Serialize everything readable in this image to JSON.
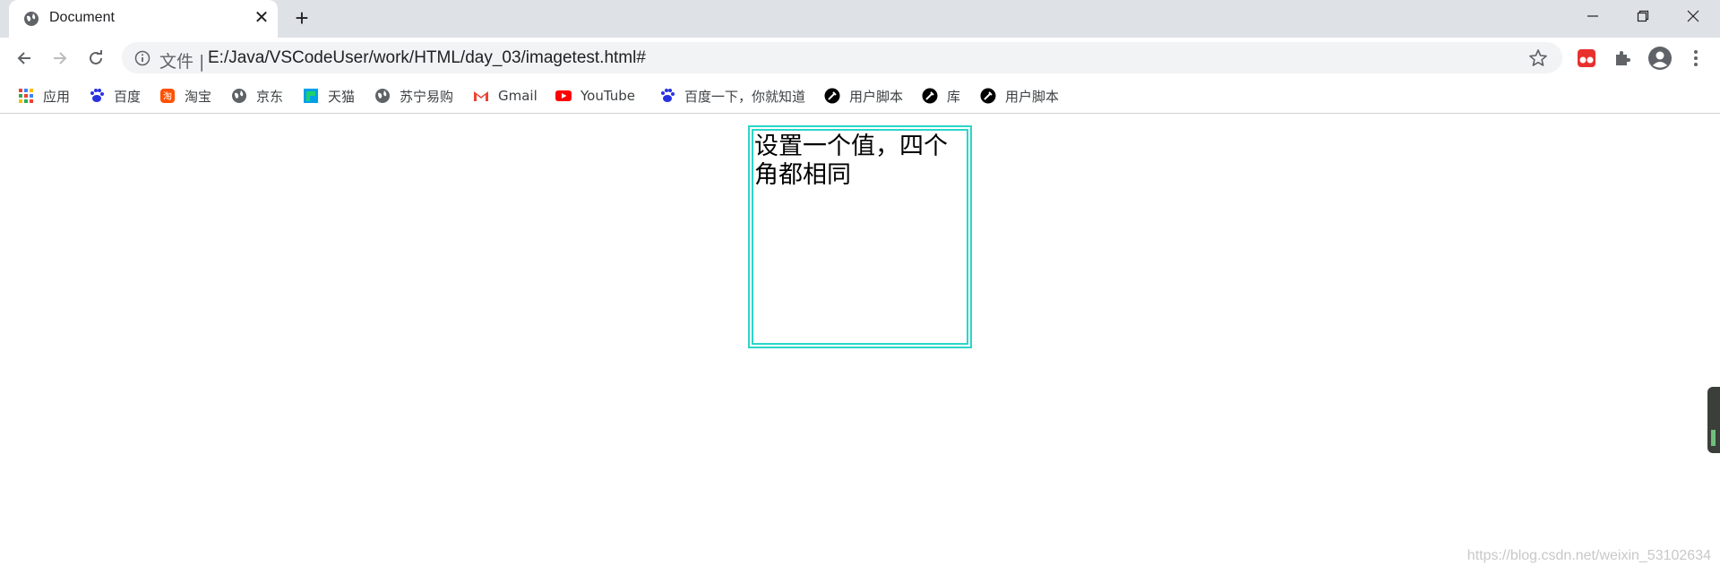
{
  "browser": {
    "tab_title": "Document",
    "address": {
      "file_label": "文件 |",
      "url": "E:/Java/VSCodeUser/work/HTML/day_03/imagetest.html#"
    }
  },
  "bookmarks": [
    {
      "label": "应用",
      "icon": "apps-grid-icon",
      "color": "#4285f4"
    },
    {
      "label": "百度",
      "icon": "baidu-paw-icon",
      "color": "#2932e1"
    },
    {
      "label": "淘宝",
      "icon": "taobao-icon",
      "color": "#ff5000"
    },
    {
      "label": "京东",
      "icon": "globe-icon",
      "color": "#5f6368"
    },
    {
      "label": "天猫",
      "icon": "tmall-icon",
      "color": "#00a0e9"
    },
    {
      "label": "苏宁易购",
      "icon": "globe-icon",
      "color": "#5f6368"
    },
    {
      "label": "Gmail",
      "icon": "gmail-icon",
      "color": "#ea4335"
    },
    {
      "label": "YouTube",
      "icon": "youtube-icon",
      "color": "#ff0000"
    },
    {
      "label": "百度一下，你就知道",
      "icon": "baidu-paw-icon",
      "color": "#2932e1"
    },
    {
      "label": "用户脚本",
      "icon": "userscript-icon",
      "color": "#000000"
    },
    {
      "label": "库",
      "icon": "userscript-icon",
      "color": "#000000"
    },
    {
      "label": "用户脚本",
      "icon": "userscript-icon",
      "color": "#000000"
    }
  ],
  "page": {
    "box_text": "设置一个值，四个角都相同",
    "box_border_color": "#2bd6c8"
  },
  "watermark": "https://blog.csdn.net/weixin_53102634"
}
